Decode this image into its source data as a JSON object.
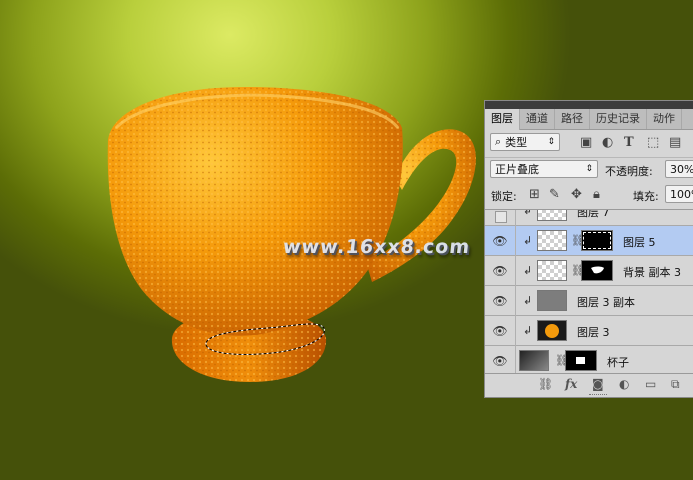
{
  "watermark": "www.16xx8.com",
  "panel": {
    "tabs": [
      "图层",
      "通道",
      "路径",
      "历史记录",
      "动作"
    ],
    "filter": {
      "label": "类型",
      "icon": "search-icon"
    },
    "blend_mode": "正片叠底",
    "opacity_label": "不透明度:",
    "opacity_value": "30%",
    "lock_label": "锁定:",
    "fill_label": "填充:",
    "fill_value": "100%",
    "layers": [
      {
        "name": "图层 7",
        "visible": false,
        "clipped": true,
        "mask": false,
        "selected": false
      },
      {
        "name": "图层 5",
        "visible": true,
        "clipped": true,
        "mask": true,
        "selected": true
      },
      {
        "name": "背景 副本 3",
        "visible": true,
        "clipped": true,
        "mask": true,
        "selected": false
      },
      {
        "name": "图层 3 副本",
        "visible": true,
        "clipped": true,
        "mask": false,
        "selected": false
      },
      {
        "name": "图层 3",
        "visible": true,
        "clipped": true,
        "mask": false,
        "selected": false
      },
      {
        "name": "杯子",
        "visible": true,
        "clipped": false,
        "mask": true,
        "selected": false
      }
    ],
    "footer_icons": [
      "link-icon",
      "fx-icon",
      "mask-icon",
      "adjustment-icon",
      "folder-icon",
      "new-layer-icon"
    ],
    "footer_fx": "fx"
  },
  "colors": {
    "canvas_light": "#dcea63",
    "canvas_dark": "#45510a",
    "cup_orange": "#f39a0c",
    "selection": "#b3cbf2"
  }
}
